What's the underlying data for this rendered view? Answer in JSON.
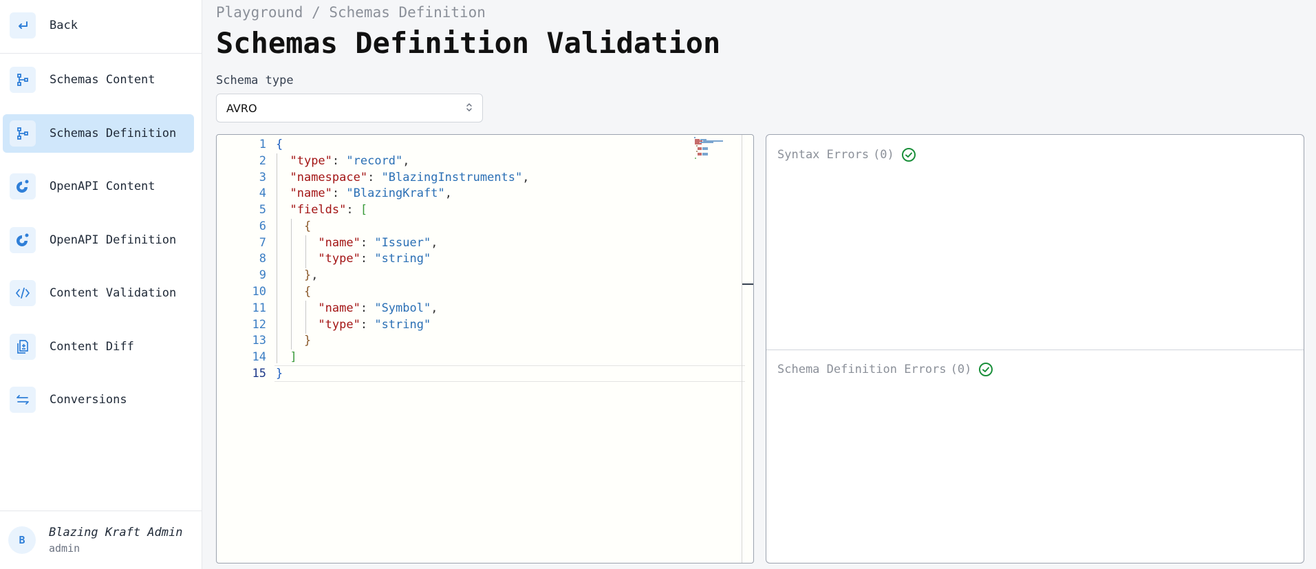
{
  "sidebar": {
    "back_label": "Back",
    "items": [
      {
        "label": "Schemas Content",
        "icon": "schema-tree-icon"
      },
      {
        "label": "Schemas Definition",
        "icon": "schema-tree-icon",
        "active": true
      },
      {
        "label": "OpenAPI Content",
        "icon": "openapi-icon"
      },
      {
        "label": "OpenAPI Definition",
        "icon": "openapi-icon"
      },
      {
        "label": "Content Validation",
        "icon": "code-icon"
      },
      {
        "label": "Content Diff",
        "icon": "diff-icon"
      },
      {
        "label": "Conversions",
        "icon": "swap-icon"
      }
    ],
    "user": {
      "avatar_letter": "B",
      "name": "Blazing Kraft Admin",
      "role": "admin"
    }
  },
  "header": {
    "breadcrumb": "Playground / Schemas Definition",
    "title": "Schemas Definition Validation"
  },
  "form": {
    "schema_type_label": "Schema type",
    "schema_type_value": "AVRO"
  },
  "editor": {
    "line_numbers": [
      "1",
      "2",
      "3",
      "4",
      "5",
      "6",
      "7",
      "8",
      "9",
      "10",
      "11",
      "12",
      "13",
      "14",
      "15"
    ],
    "active_line": "15"
  },
  "errors": {
    "syntax_label": "Syntax Errors",
    "syntax_count": "(0)",
    "definition_label": "Schema Definition Errors",
    "definition_count": "(0)"
  },
  "colors": {
    "accent": "#2f7fd8",
    "active_bg": "#d0e7fb",
    "ok_green": "#1a8f3a"
  }
}
